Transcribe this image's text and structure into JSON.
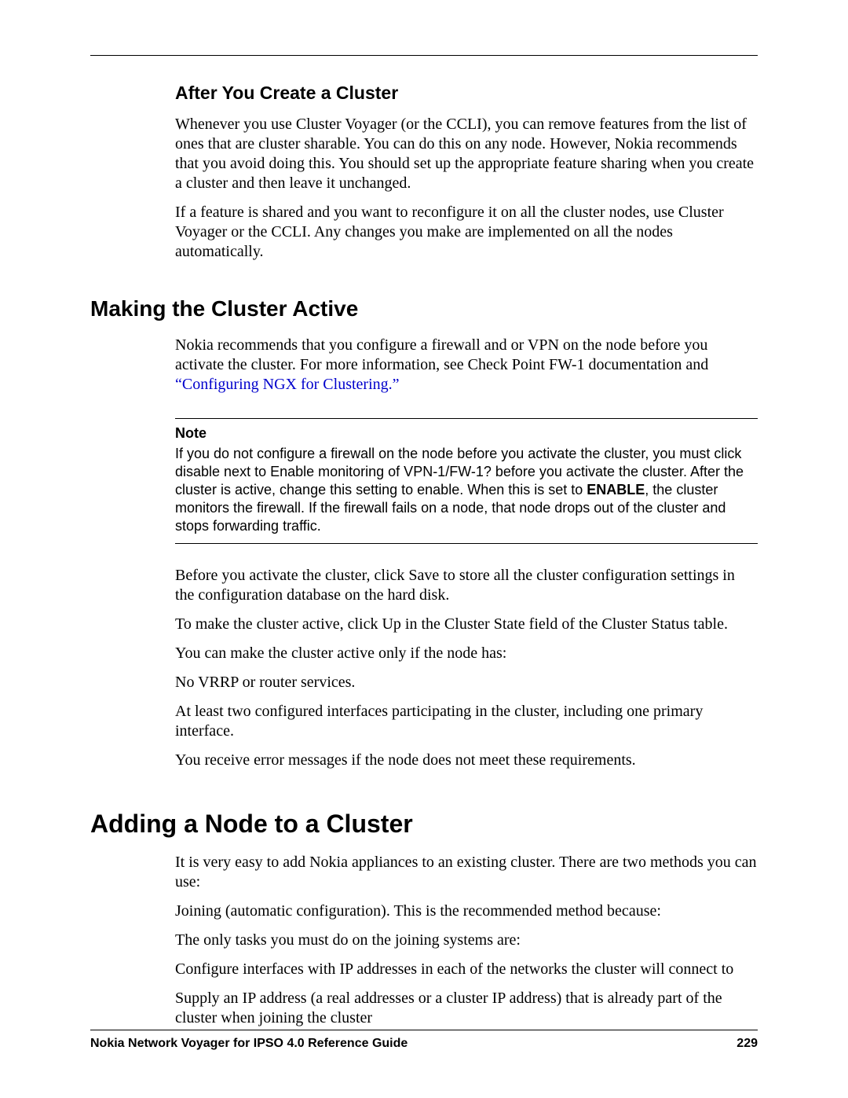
{
  "sec_after": {
    "heading": "After You Create a Cluster",
    "p1": "Whenever you use Cluster Voyager (or the CCLI), you can remove features from the list of ones that are cluster sharable. You can do this on any node. However, Nokia recommends that you avoid doing this. You should set up the appropriate feature sharing when you create a cluster and then leave it unchanged.",
    "p2": "If a feature is shared and you want to reconfigure it on all the cluster nodes, use Cluster Voyager or the CCLI. Any changes you make are implemented on all the nodes automatically."
  },
  "sec_active": {
    "heading": "Making the Cluster Active",
    "p1a": "Nokia recommends that you configure a firewall and or VPN on the node before you activate the cluster. For more information, see Check Point FW-1 documentation and ",
    "link": "“Configuring NGX for Clustering.”",
    "note": {
      "label": "Note",
      "t1": "If you do not configure a firewall on the node before you activate the cluster, you must click disable next to Enable monitoring of VPN-1/FW-1? before you activate the cluster. After the cluster is active, change this setting to enable. When this is set to ",
      "t_strong": "ENABLE",
      "t2": ", the cluster monitors the firewall. If the firewall fails on a node, that node drops out of the cluster and stops forwarding traffic."
    },
    "p2": "Before you activate the cluster, click Save to store all the cluster configuration settings in the configuration database on the hard disk.",
    "p3": "To make the cluster active, click Up in the Cluster State field of the Cluster Status table.",
    "p4": "You can make the cluster active only if the node has:",
    "b1": "No VRRP or router services.",
    "b2": "At least two configured interfaces participating in the cluster, including one primary interface.",
    "p5": "You receive error messages if the node does not meet these requirements."
  },
  "sec_add": {
    "heading": "Adding a Node to a Cluster",
    "p1": "It is very easy to add Nokia appliances to an existing cluster. There are two methods you can use:",
    "b1": "Joining (automatic configuration). This is the recommended method because:",
    "b1_1": "The only tasks you must do on the joining systems are:",
    "b1_1_1": "Configure interfaces with IP addresses in each of the networks the cluster will connect to",
    "b1_1_2": "Supply an IP address (a real addresses or a cluster IP address) that is already part of the cluster when joining the cluster"
  },
  "footer": {
    "title": "Nokia Network Voyager for IPSO 4.0 Reference Guide",
    "page": "229"
  }
}
